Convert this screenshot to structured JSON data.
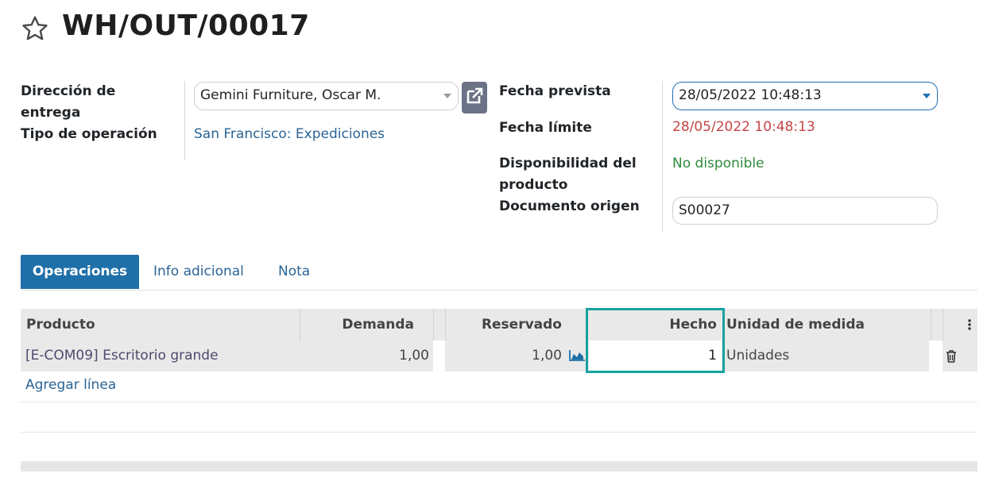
{
  "record": {
    "title": "WH/OUT/00017"
  },
  "form": {
    "delivery_address_label": "Dirección de\nentrega",
    "delivery_address_value": "Gemini Furniture, Oscar M.",
    "operation_type_label": "Tipo de operación",
    "operation_type_value": "San Francisco: Expediciones",
    "scheduled_date_label": "Fecha prevista",
    "scheduled_date_value": "28/05/2022 10:48:13",
    "deadline_label": "Fecha límite",
    "deadline_value": "28/05/2022 10:48:13",
    "availability_label": "Disponibilidad del\nproducto",
    "availability_value": "No disponible",
    "source_document_label": "Documento origen",
    "source_document_value": "S00027"
  },
  "tabs": {
    "operations": "Operaciones",
    "additional_info": "Info adicional",
    "note": "Nota"
  },
  "table": {
    "headers": {
      "product": "Producto",
      "demand": "Demanda",
      "reserved": "Reservado",
      "done": "Hecho",
      "uom": "Unidad de medida"
    },
    "rows": [
      {
        "product": "[E-COM09] Escritorio grande",
        "demand": "1,00",
        "reserved": "1,00",
        "done": "1",
        "uom": "Unidades"
      }
    ],
    "add_line": "Agregar línea"
  },
  "icons": {
    "favorite": "star-outline-icon",
    "external_link": "external-link-icon",
    "forecast": "area-chart-icon",
    "delete": "trash-icon",
    "options": "vertical-dots-icon"
  },
  "colors": {
    "primary": "#1f6fa8",
    "highlight": "#17a2a0",
    "deadline": "#c54545",
    "availability": "#2f8a3a"
  }
}
